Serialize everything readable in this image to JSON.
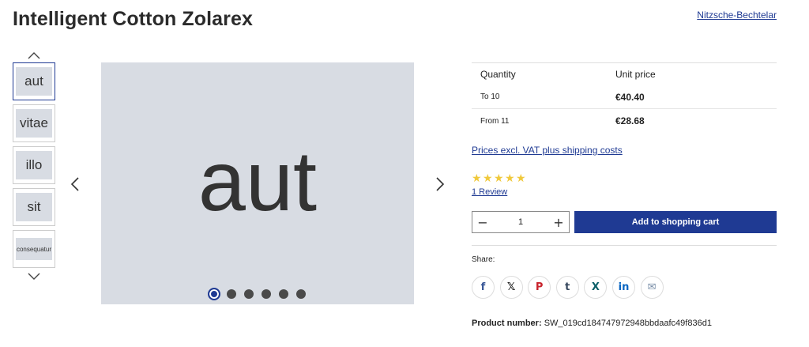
{
  "product": {
    "title": "Intelligent Cotton Zolarex",
    "brand": "Nitzsche-Bechtelar",
    "main_image_text": "aut",
    "product_number_label": "Product number:",
    "product_number": "SW_019cd184747972948bbdaafc49f836d1"
  },
  "gallery": {
    "thumbnails": [
      {
        "label": "aut",
        "active": true
      },
      {
        "label": "vitae",
        "active": false
      },
      {
        "label": "illo",
        "active": false
      },
      {
        "label": "sit",
        "active": false
      },
      {
        "label": "consequatur",
        "active": false
      }
    ],
    "dots_count": 6,
    "active_dot": 0
  },
  "pricing": {
    "header_quantity": "Quantity",
    "header_unit_price": "Unit price",
    "rows": [
      {
        "quantity": "To 10",
        "price": "€40.40"
      },
      {
        "quantity": "From 11",
        "price": "€28.68"
      }
    ],
    "vat_link": "Prices excl. VAT plus shipping costs"
  },
  "rating": {
    "stars": 5,
    "review_link": "1 Review",
    "star_color": "#f0c93c"
  },
  "cart": {
    "quantity": "1",
    "add_label": "Add to shopping cart",
    "accent_color": "#1f3a93"
  },
  "share": {
    "label": "Share:",
    "networks": [
      {
        "name": "facebook-icon",
        "glyph": "f",
        "color": "#3b5998"
      },
      {
        "name": "x-icon",
        "glyph": "𝕏",
        "color": "#111111"
      },
      {
        "name": "pinterest-icon",
        "glyph": "P",
        "color": "#c8232c"
      },
      {
        "name": "tumblr-icon",
        "glyph": "t",
        "color": "#35465c"
      },
      {
        "name": "xing-icon",
        "glyph": "X",
        "color": "#0b5f68"
      },
      {
        "name": "linkedin-icon",
        "glyph": "in",
        "color": "#0a66c2"
      },
      {
        "name": "mail-icon",
        "glyph": "✉",
        "color": "#7a8fa8"
      }
    ]
  }
}
